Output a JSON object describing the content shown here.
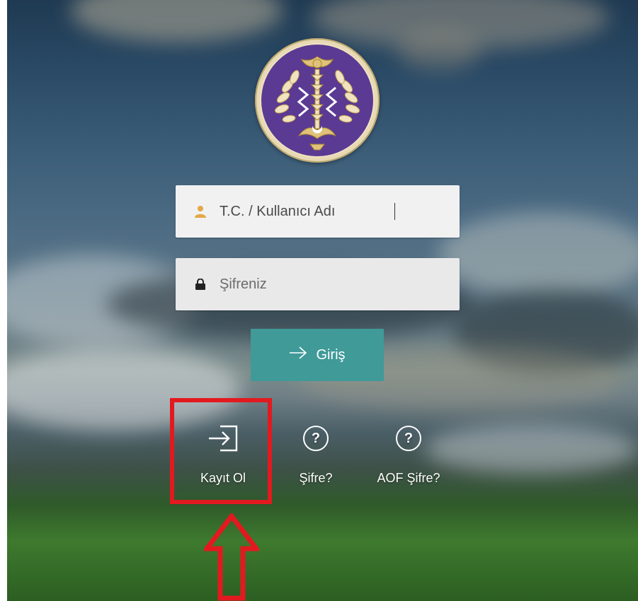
{
  "login_form": {
    "username_placeholder": "T.C. / Kullanıcı Adı",
    "password_placeholder": "Şifreniz",
    "submit_label": "Giriş"
  },
  "links": {
    "register_label": "Kayıt Ol",
    "forgot_password_label": "Şifre?",
    "aof_forgot_password_label": "AOF Şifre?"
  },
  "icons": {
    "logo": "university-emblem",
    "username": "user-icon",
    "password": "lock-icon",
    "submit": "arrow-right-icon",
    "register": "sign-in-icon",
    "forgot": "question-circle-icon",
    "aof_forgot": "question-circle-icon",
    "annotation_arrow": "red-up-arrow"
  },
  "colors": {
    "submit_button": "#3f9a98",
    "logo_fill": "#5b3a94",
    "logo_ring": "#e7d9b4",
    "annotation": "#e21a1f",
    "user_icon": "#e3a848"
  }
}
